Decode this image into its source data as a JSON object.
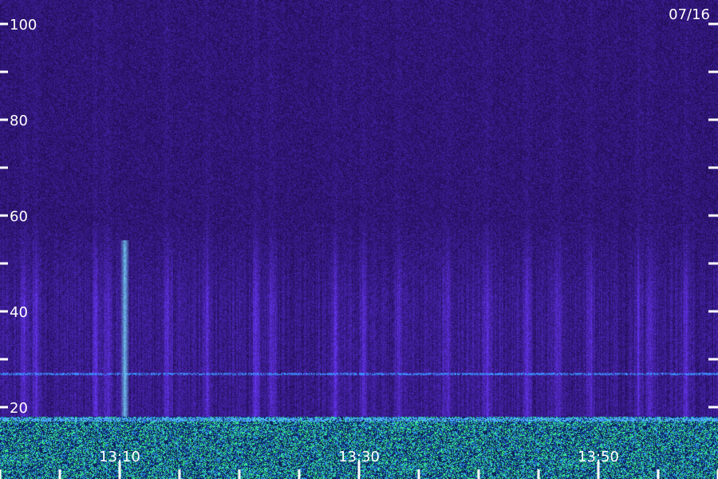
{
  "date_label": "07/16",
  "chart_data": {
    "type": "heatmap",
    "title": "",
    "xlabel": "",
    "ylabel": "",
    "y_range": [
      0,
      100
    ],
    "x_range_minutes": [
      0,
      60
    ],
    "y_major_ticks": [
      20,
      40,
      60,
      80,
      100
    ],
    "y_minor_ticks": [
      30,
      50,
      70,
      90
    ],
    "y_tick_labels": [
      "20",
      "40",
      "60",
      "80",
      "100"
    ],
    "x_major_ticks": [
      "13:10",
      "13:30",
      "13:50"
    ],
    "x_tick_labels": [
      "13:10",
      "13:30",
      "13:50"
    ],
    "x_minor_tick_step_minutes": 5,
    "colors": {
      "background": "#2a0e48",
      "noise_low": "#1a0a60",
      "noise_high": "#4a2cc8",
      "signal": "#3a8cff",
      "hot": "#8cf0ff",
      "green": "#40ff80",
      "axis": "#ffffff"
    },
    "features": [
      {
        "kind": "vertical_burst",
        "time": "13:10",
        "y_from": 0,
        "y_to": 55
      },
      {
        "kind": "horizontal_band",
        "y": 28
      },
      {
        "kind": "low_band",
        "y_from": 0,
        "y_to": 18
      }
    ]
  }
}
